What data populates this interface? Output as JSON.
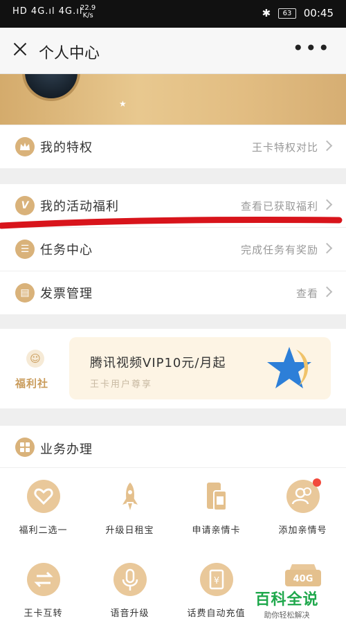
{
  "status_bar": {
    "left": "HD 4G.ıl 4G.ıl",
    "speed": "22.9",
    "speed_unit": "K/s",
    "battery": "63",
    "time": "00:45"
  },
  "nav": {
    "title": "个人中心",
    "more": "•••"
  },
  "section1": {
    "privilege": {
      "label": "我的特权",
      "sub": "王卡特权对比",
      "icon": "crown-icon"
    }
  },
  "section2": {
    "rows": [
      {
        "label": "我的活动福利",
        "sub": "查看已获取福利",
        "icon": "v-icon",
        "glyph": "V"
      },
      {
        "label": "任务中心",
        "sub": "完成任务有奖励",
        "icon": "list-icon",
        "glyph": "☰"
      },
      {
        "label": "发票管理",
        "sub": "查看",
        "icon": "ticket-icon",
        "glyph": "▤"
      }
    ]
  },
  "welfare": {
    "badge_label": "福利社",
    "promo_title": "腾讯视频VIP10元/月起",
    "promo_sub": "王卡用户尊享"
  },
  "business": {
    "title": "业务办理",
    "tiles": [
      {
        "label": "福利二选一",
        "icon": "heart-icon",
        "glyph": "♡"
      },
      {
        "label": "升级日租宝",
        "icon": "rocket-icon",
        "glyph": "🚀"
      },
      {
        "label": "申请亲情卡",
        "icon": "sim-card-icon",
        "glyph": "▣"
      },
      {
        "label": "添加亲情号",
        "icon": "add-contact-icon",
        "glyph": "👥"
      },
      {
        "label": "王卡互转",
        "icon": "transfer-icon",
        "glyph": "⇄"
      },
      {
        "label": "语音升级",
        "icon": "microphone-icon",
        "glyph": "🎤"
      },
      {
        "label": "话费自动充值",
        "icon": "bill-icon",
        "glyph": "¥"
      },
      {
        "label": "",
        "icon": "40g-icon",
        "glyph": "40G"
      }
    ]
  },
  "watermark": {
    "main": "百科全说",
    "sub": "助你轻松解决"
  },
  "colors": {
    "accent": "#d9b27a",
    "welfare_text": "#c99b5a",
    "annotation_red": "#d8141b"
  }
}
